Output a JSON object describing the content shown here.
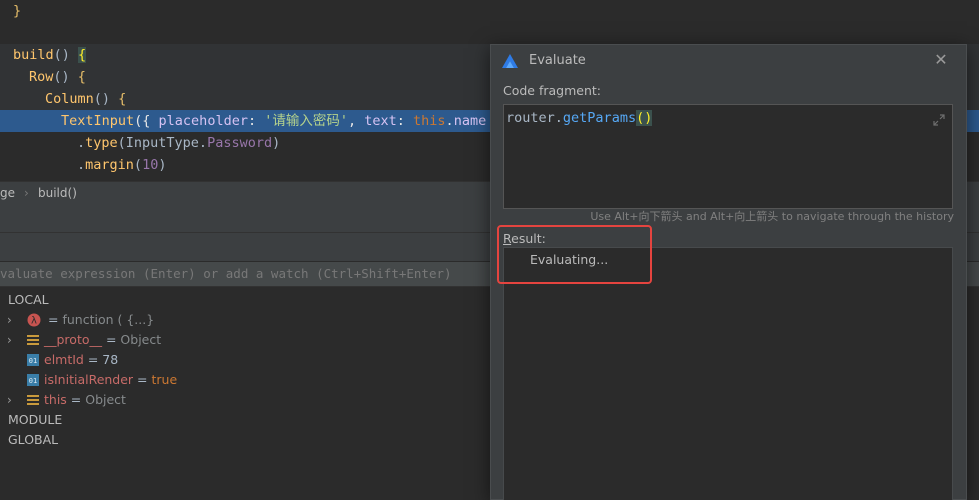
{
  "editor": {
    "lines": [
      {
        "id": "l1",
        "parts": [
          {
            "t": "}",
            "c": "brace-y"
          }
        ]
      },
      {
        "id": "l2",
        "parts": [
          {
            "t": "build",
            "c": "fn"
          },
          {
            "t": "() ",
            "c": "plain"
          },
          {
            "t": "{",
            "c": "brace-h"
          }
        ]
      },
      {
        "id": "l3",
        "parts": [
          {
            "t": "Row",
            "c": "fn"
          },
          {
            "t": "() ",
            "c": "plain"
          },
          {
            "t": "{",
            "c": "brace-y"
          }
        ]
      },
      {
        "id": "l4",
        "parts": [
          {
            "t": "Column",
            "c": "fn"
          },
          {
            "t": "() ",
            "c": "plain"
          },
          {
            "t": "{",
            "c": "brace-y"
          }
        ]
      },
      {
        "id": "l5",
        "parts": [
          {
            "t": "TextInput",
            "c": "fn"
          },
          {
            "t": "({ ",
            "c": "plain"
          },
          {
            "t": "placeholder",
            "c": "prop"
          },
          {
            "t": ": ",
            "c": "plain"
          },
          {
            "t": "'请输入密码'",
            "c": "str"
          },
          {
            "t": ", ",
            "c": "plain"
          },
          {
            "t": "text",
            "c": "prop"
          },
          {
            "t": ": ",
            "c": "plain"
          },
          {
            "t": "this",
            "c": "kw"
          },
          {
            "t": ".",
            "c": "plain"
          },
          {
            "t": "name",
            "c": "prop"
          }
        ]
      },
      {
        "id": "l6",
        "parts": [
          {
            "t": ".",
            "c": "plain"
          },
          {
            "t": "type",
            "c": "fn"
          },
          {
            "t": "(InputType.",
            "c": "plain"
          },
          {
            "t": "Password",
            "c": "prop"
          },
          {
            "t": ")",
            "c": "plain"
          }
        ]
      },
      {
        "id": "l7",
        "parts": [
          {
            "t": ".",
            "c": "plain"
          },
          {
            "t": "margin",
            "c": "fn"
          },
          {
            "t": "(",
            "c": "plain"
          },
          {
            "t": "10",
            "c": "prop"
          },
          {
            "t": ")",
            "c": "plain"
          }
        ]
      }
    ]
  },
  "breadcrumb": {
    "first": "ge",
    "separator": "›",
    "second": "build()"
  },
  "watch": {
    "placeholder": "valuate expression (Enter) or add a watch (Ctrl+Shift+Enter)"
  },
  "variables": {
    "local_label": "LOCAL",
    "module_label": "MODULE",
    "global_label": "GLOBAL",
    "items": [
      {
        "name": "",
        "eq": "= ",
        "value": "function ( {...}",
        "icon": "lambda-icon",
        "expandable": true
      },
      {
        "name": "__proto__",
        "eq": " = ",
        "value": "Object",
        "icon": "object-icon",
        "expandable": true
      },
      {
        "name": "elmtId",
        "eq": " = ",
        "value": "78",
        "icon": "number-field-icon",
        "expandable": false
      },
      {
        "name": "isInitialRender",
        "eq": " = ",
        "value": "true",
        "icon": "number-field-icon",
        "expandable": false
      },
      {
        "name": "this",
        "eq": " = ",
        "value": "Object",
        "icon": "object-icon",
        "expandable": true
      }
    ]
  },
  "dialog": {
    "title": "Evaluate",
    "close_glyph": "✕",
    "code_label": "Code fragment:",
    "code": {
      "object": "router",
      "dot": ".",
      "method": "getParams",
      "parens": "()"
    },
    "history_hint": "Use Alt+向下箭头 and Alt+向上箭头 to navigate through the history",
    "result_label_first": "R",
    "result_label_rest": "esult:",
    "result_status": "Evaluating..."
  },
  "colors": {
    "highlight": "#e5443f",
    "exec_line": "#2d5a8e",
    "logo_blue": "#2e7be6"
  }
}
